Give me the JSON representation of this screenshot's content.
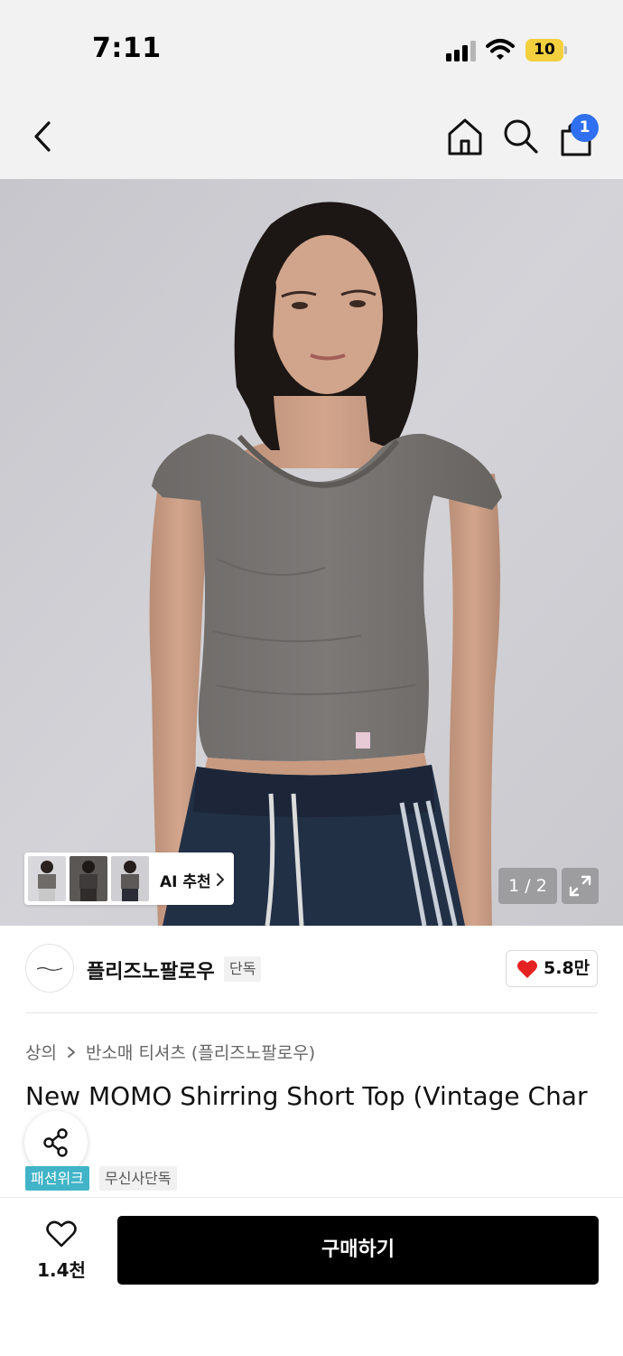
{
  "status_bar": {
    "time": "7:11",
    "battery": "10",
    "battery_color": "#f4d03f"
  },
  "nav": {
    "back_icon": "chevron-left-icon",
    "home_icon": "home-icon",
    "search_icon": "search-icon",
    "bag_icon": "shopping-bag-icon",
    "cart_count": "1",
    "badge_color": "#2f6ff0"
  },
  "gallery": {
    "ai_label": "AI 추천",
    "counter": "1 / 2",
    "expand_icon": "expand-icon"
  },
  "brand": {
    "name": "플리즈노팔로우",
    "tag": "단독",
    "likes": "5.8만",
    "heart_color": "#e52222"
  },
  "product": {
    "breadcrumb": [
      "상의",
      "반소매 티셔츠 (플리즈노팔로우)"
    ],
    "title": "New MOMO Shirring Short Top (Vintage Char",
    "tags": [
      "패션위크",
      "무신사단독"
    ],
    "tag_color": "#41b4c7"
  },
  "bottom": {
    "wish_count": "1.4천",
    "buy_label": "구매하기"
  }
}
